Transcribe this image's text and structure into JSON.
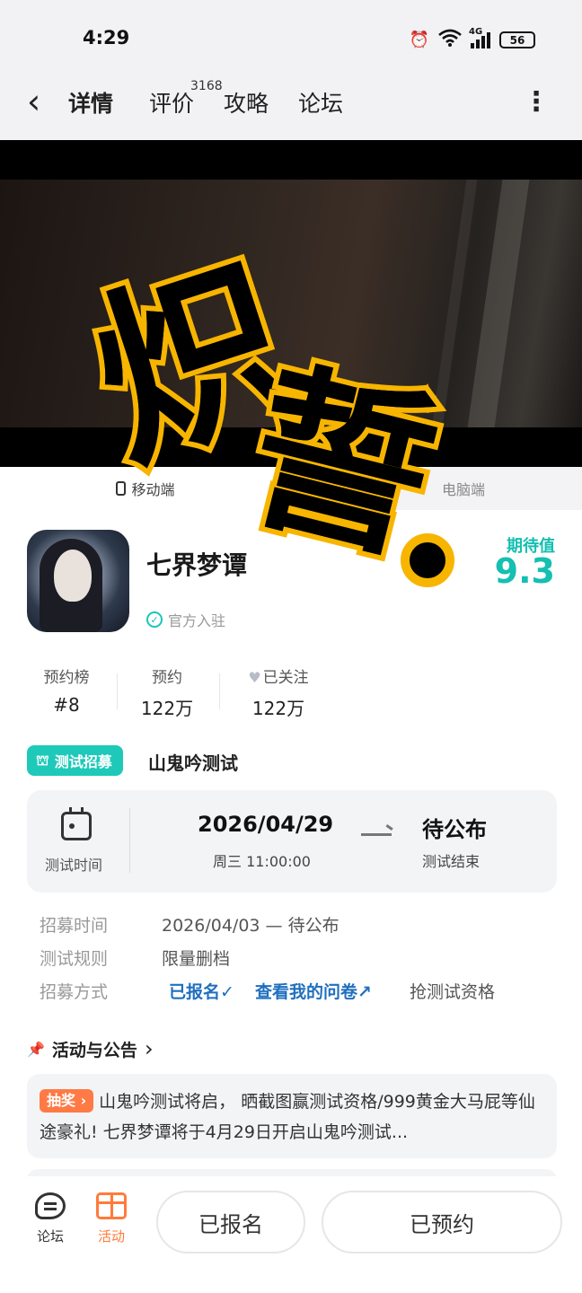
{
  "status_bar": {
    "time": "4:29",
    "network": "4G",
    "battery": "56"
  },
  "nav": {
    "back_glyph": "‹",
    "tabs": [
      {
        "label": "详情",
        "active": true
      },
      {
        "label": "评价",
        "badge": "3168"
      },
      {
        "label": "攻略"
      },
      {
        "label": "论坛"
      }
    ],
    "more_glyph": "⋮"
  },
  "hero": {
    "overlay_text_1": "炽",
    "overlay_text_2": "誓",
    "overlay_color": "#f7b500",
    "platforms": [
      "移动端",
      "电脑端"
    ]
  },
  "game": {
    "title": "七界梦谭",
    "official_label": "官方入驻",
    "expect_label": "期待值",
    "expect_value": "9.3",
    "accent_color": "#19c6b8"
  },
  "stats": [
    {
      "label": "预约榜",
      "value": "#8"
    },
    {
      "label": "预约",
      "value": "122万"
    },
    {
      "label": "已关注",
      "value": "122万"
    }
  ],
  "recruit": {
    "tag": "测试招募",
    "name": "山鬼吟测试",
    "time_label": "测试时间",
    "start_date": "2026/04/29",
    "start_time": "周三  11:00:00",
    "end_date": "待公布",
    "end_label": "测试结束",
    "rows": [
      {
        "key": "招募时间",
        "value": "2026/04/03 — 待公布"
      },
      {
        "key": "测试规则",
        "value": "限量删档"
      },
      {
        "key": "招募方式",
        "signed": "已报名✓",
        "questionnaire": "查看我的问卷↗",
        "grab": "抢测试资格"
      }
    ]
  },
  "activities": {
    "title": "活动与公告",
    "chevron": "›",
    "notice_tag": "抽奖 ›",
    "notice_text": "山鬼吟测试将启， 晒截图赢测试资格/999黄金大马屁等仙途豪礼! 七界梦谭将于4月29日开启山鬼吟测试..."
  },
  "bottom": {
    "forum_label": "论坛",
    "activity_label": "活动",
    "signed_button": "已报名",
    "reserved_button": "已预约",
    "activity_color": "#ff7b3a"
  }
}
